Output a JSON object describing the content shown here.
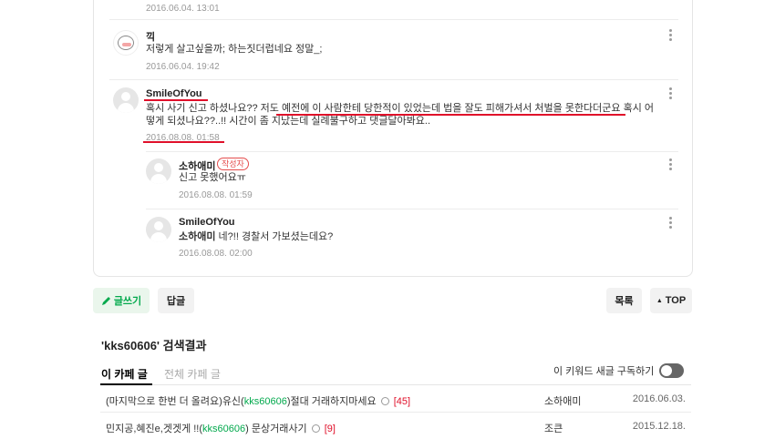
{
  "comments": [
    {
      "date": "2016.06.04. 13:01"
    },
    {
      "nick": "끽",
      "text": "저렇게 살고싶을까; 하는짓더럽네요 정말_;",
      "date": "2016.06.04. 19:42"
    },
    {
      "nick": "SmileOfYou",
      "text_line1": "혹시 사기 신고 하셨나요?? 저도 예전에 이 사람한테 당한적이 있었는데 법을 잘도 피해가셔서 처벌을 못한다더군요 혹시 어",
      "text_line2": "떻게 되셨나요??..!! 시간이 좀 지났는데 실례불구하고 댓글달아봐요..",
      "date": "2016.08.08. 01:58"
    },
    {
      "nick": "소하애미",
      "badge": "작성자",
      "text": "신고 못했어요ㅠ",
      "date": "2016.08.08. 01:59"
    },
    {
      "nick": "SmileOfYou",
      "mention": "소하애미",
      "text": "네?!! 경찰서 가보셨는데요?",
      "date": "2016.08.08. 02:00"
    }
  ],
  "buttons": {
    "write": "글쓰기",
    "reply": "답글",
    "list": "목록",
    "top": "TOP"
  },
  "search": {
    "title": "'kks60606'  검색결과",
    "tabs": [
      "이 카페 글",
      "전체 카페 글"
    ],
    "subscribe_label": "이 키워드 새글 구독하기",
    "subscribe_on": false,
    "results": [
      {
        "pre": "(마지막으로 한번 더 올려요)유신(",
        "keyword": "kks60606",
        "post": ")절대 거래하지마세요",
        "count": "[45]",
        "author": "소하애미",
        "date": "2016.06.03."
      },
      {
        "pre": "민지공,혜진e,겟겟게 !!(",
        "keyword": "kks60606",
        "post": ") 문상거래사기",
        "count": "[9]",
        "author": "조큰",
        "date": "2015.12.18."
      }
    ]
  },
  "colors": {
    "accent_green": "#03a94d",
    "annotation_red": "#e0102a",
    "badge_red": "#e54d4d"
  }
}
